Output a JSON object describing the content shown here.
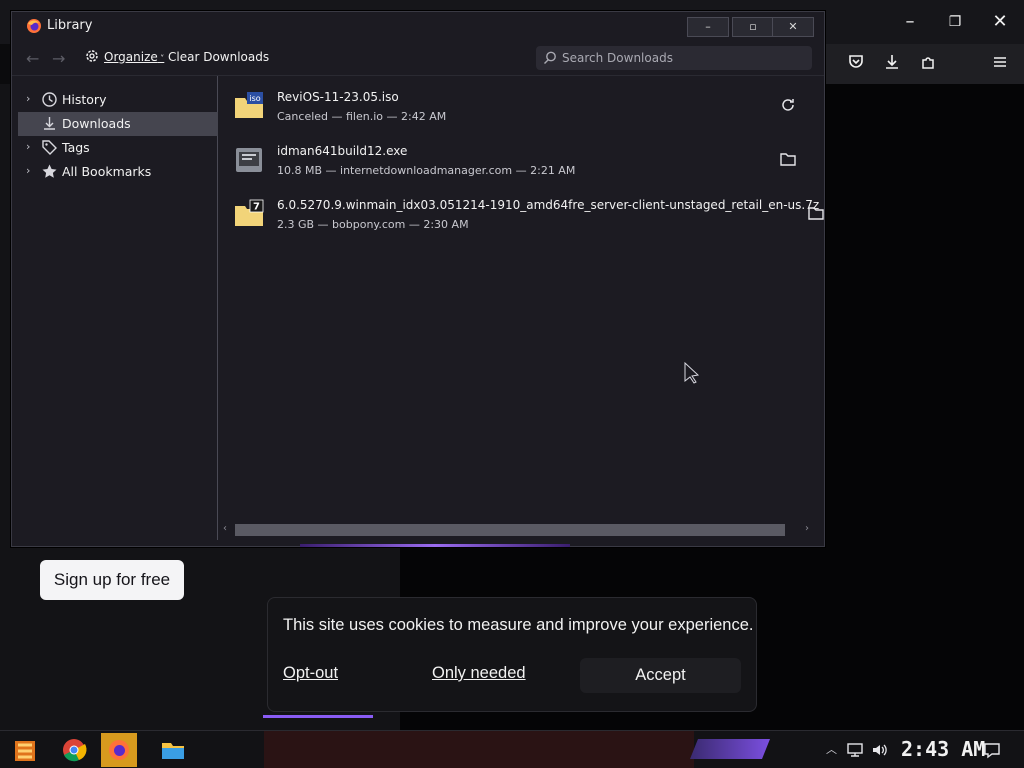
{
  "browser": {
    "window_controls": {
      "minimize": "–",
      "maximize": "❐",
      "close": "✕"
    },
    "toolbar_icons": [
      "pocket-icon",
      "download-icon",
      "extensions-icon",
      "menu-icon"
    ]
  },
  "page": {
    "signup_label": "Sign up for free",
    "cookie": {
      "text": "This site uses cookies to measure and improve your experience.",
      "opt_out": "Opt-out",
      "only_needed": "Only needed",
      "accept": "Accept"
    }
  },
  "library": {
    "title": "Library",
    "window_controls": {
      "minimize": "–",
      "maximize": "▫",
      "close": "✕"
    },
    "toolbar": {
      "organize_label": "Organize",
      "clear_label": "Clear Downloads",
      "search_placeholder": "Search Downloads"
    },
    "sidebar": [
      {
        "label": "History",
        "icon": "clock-icon",
        "expandable": true,
        "selected": false
      },
      {
        "label": "Downloads",
        "icon": "download-icon",
        "expandable": false,
        "selected": true
      },
      {
        "label": "Tags",
        "icon": "tags-icon",
        "expandable": true,
        "selected": false
      },
      {
        "label": "All Bookmarks",
        "icon": "star-icon",
        "expandable": true,
        "selected": false
      }
    ],
    "downloads": [
      {
        "name": "ReviOS-11-23.05.iso",
        "meta": "Canceled — filen.io — 2:42 AM",
        "file_icon": "iso-file-icon",
        "action": "retry-icon"
      },
      {
        "name": "idman641build12.exe",
        "meta": "10.8 MB — internetdownloadmanager.com — 2:21 AM",
        "file_icon": "exe-file-icon",
        "action": "folder-icon"
      },
      {
        "name": "6.0.5270.9.winmain_idx03.051214-1910_amd64fre_server-client-unstaged_retail_en-us.7z",
        "meta": "2.3 GB — bobpony.com — 2:30 AM",
        "file_icon": "7z-file-icon",
        "action": "folder-icon"
      }
    ]
  },
  "taskbar": {
    "apps": [
      "start-icon",
      "chrome-icon",
      "firefox-icon",
      "file-explorer-icon"
    ],
    "clock": "2:43 AM"
  },
  "colors": {
    "accent": "#8a5cf5",
    "window_bg": "#1c1b22",
    "selected_bg": "#45454f"
  }
}
